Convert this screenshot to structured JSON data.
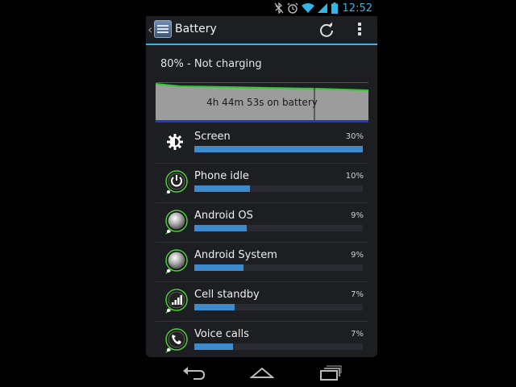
{
  "status_bar": {
    "time": "12:52",
    "icons": [
      "bluetooth-off-icon",
      "alarm-icon",
      "wifi-icon",
      "signal-icon",
      "battery-icon"
    ]
  },
  "action_bar": {
    "title": "Battery",
    "icons": [
      "back-chevron-icon",
      "battery-app-icon",
      "refresh-icon",
      "overflow-menu-icon"
    ]
  },
  "battery": {
    "status_text": "80% - Not charging",
    "graph_label": "4h 44m 53s on battery"
  },
  "usage": [
    {
      "name": "Screen",
      "percent_label": "30%",
      "fraction": 1.0,
      "icon": "brightness-icon"
    },
    {
      "name": "Phone idle",
      "percent_label": "10%",
      "fraction": 0.33,
      "icon": "power-icon"
    },
    {
      "name": "Android OS",
      "percent_label": "9%",
      "fraction": 0.31,
      "icon": "android-os-icon"
    },
    {
      "name": "Android System",
      "percent_label": "9%",
      "fraction": 0.29,
      "icon": "android-system-icon"
    },
    {
      "name": "Cell standby",
      "percent_label": "7%",
      "fraction": 0.24,
      "icon": "cell-signal-icon"
    },
    {
      "name": "Voice calls",
      "percent_label": "7%",
      "fraction": 0.23,
      "icon": "phone-call-icon"
    }
  ],
  "navigation_bar": {
    "icons": [
      "back-icon",
      "home-icon",
      "recent-apps-icon"
    ]
  },
  "colors": {
    "accent": "#33b5e5",
    "usage_bar": "#3d8bcc",
    "graph_line": "#2ecc2e",
    "graph_fill": "#9c9c9c"
  }
}
